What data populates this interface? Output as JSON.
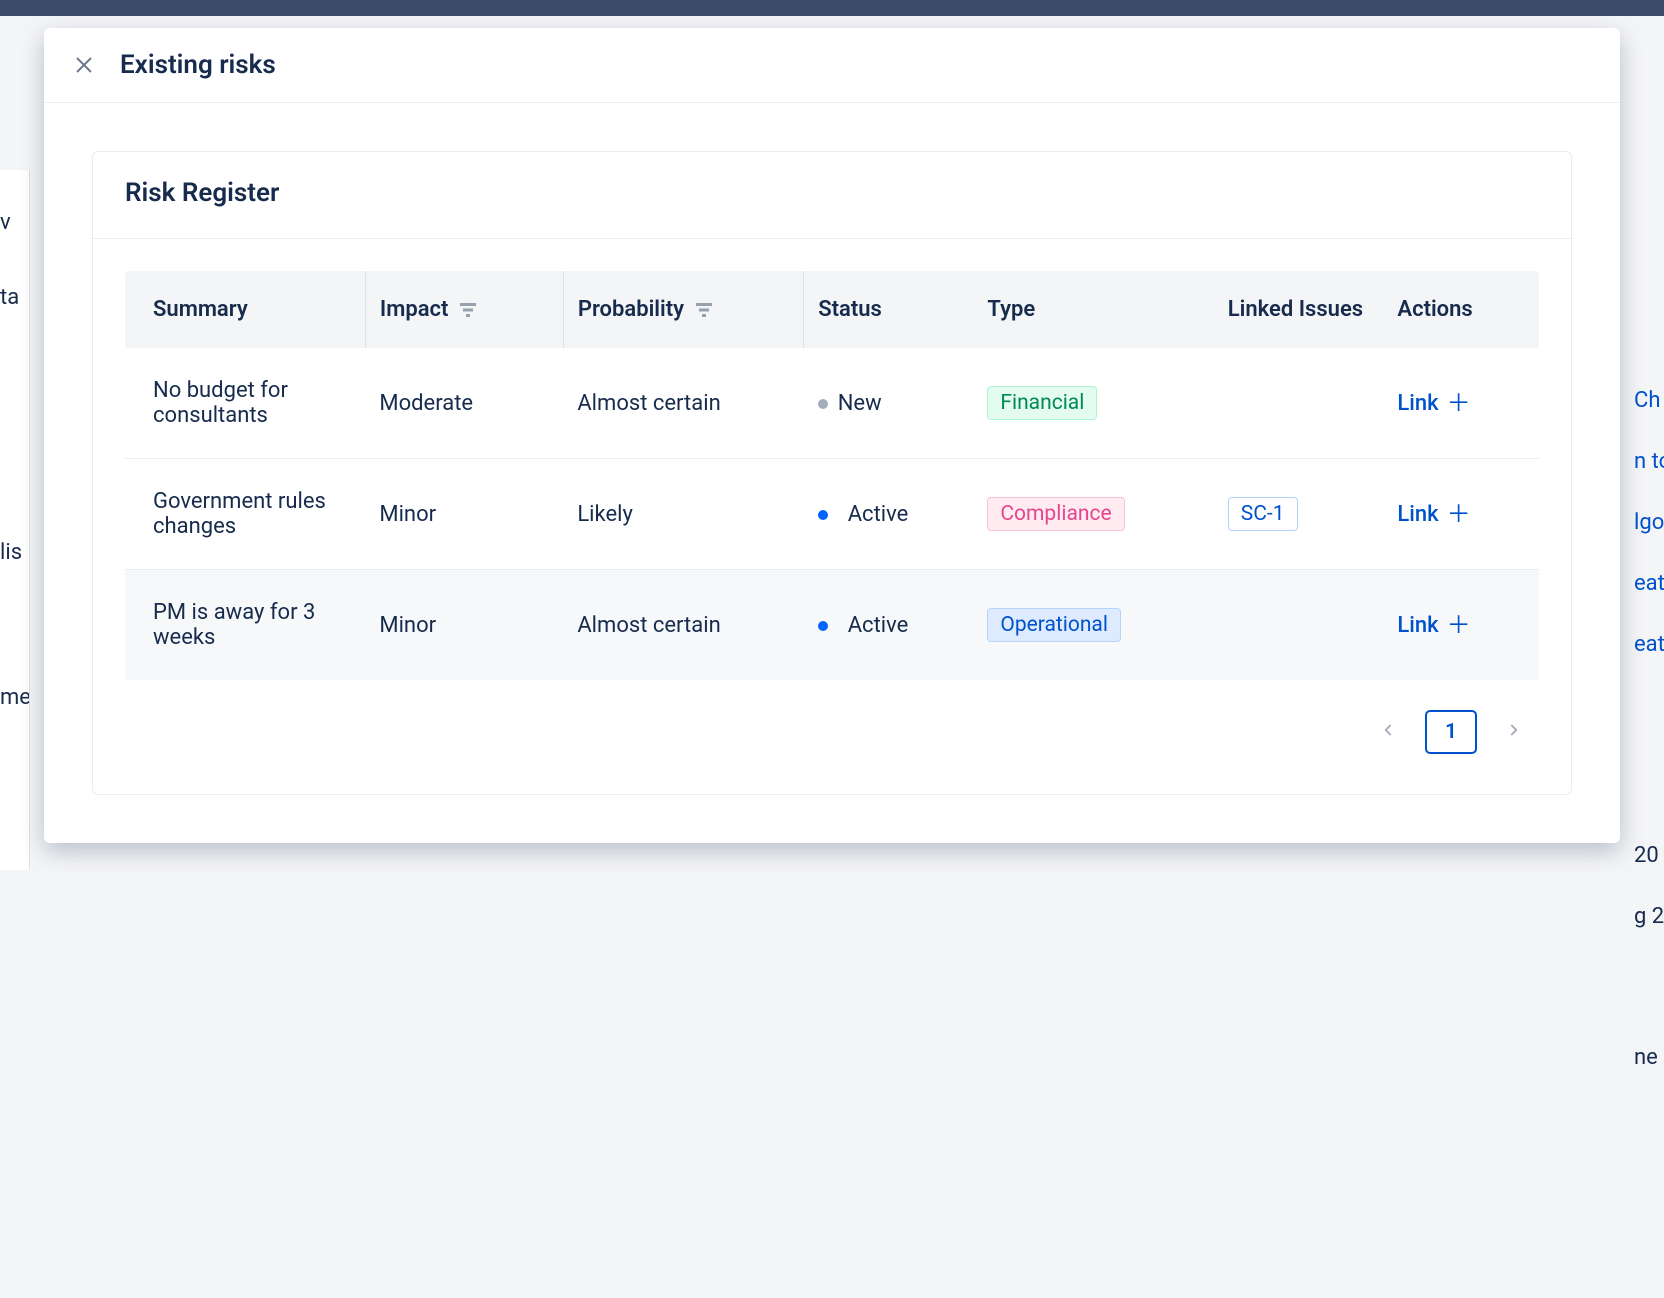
{
  "modal": {
    "title": "Existing risks"
  },
  "card": {
    "title": "Risk Register"
  },
  "columns": {
    "summary": "Summary",
    "impact": "Impact",
    "probability": "Probability",
    "status": "Status",
    "type": "Type",
    "linked": "Linked Issues",
    "actions": "Actions"
  },
  "rows": [
    {
      "summary": "No budget for consultants",
      "impact": "Moderate",
      "probability": "Almost certain",
      "status": {
        "label": "New",
        "kind": "new"
      },
      "type": {
        "label": "Financial",
        "kind": "financial"
      },
      "linked": "",
      "action": "Link"
    },
    {
      "summary": "Government rules changes",
      "impact": "Minor",
      "probability": "Likely",
      "status": {
        "label": "Active",
        "kind": "active"
      },
      "type": {
        "label": "Compliance",
        "kind": "compliance"
      },
      "linked": "SC-1",
      "action": "Link"
    },
    {
      "summary": "PM is away for 3 weeks",
      "impact": "Minor",
      "probability": "Almost certain",
      "status": {
        "label": "Active",
        "kind": "active"
      },
      "type": {
        "label": "Operational",
        "kind": "operational"
      },
      "linked": "",
      "action": "Link"
    }
  ],
  "pagination": {
    "current": "1"
  },
  "background": {
    "left1": "v",
    "left2": "ta",
    "left3": "lis",
    "left4": "me",
    "right1": "Ch",
    "right2": "n to",
    "right3": "lgo",
    "right4": "eat",
    "right5": "eat",
    "right6": "20",
    "right7": "g 2",
    "right8": "ne"
  }
}
